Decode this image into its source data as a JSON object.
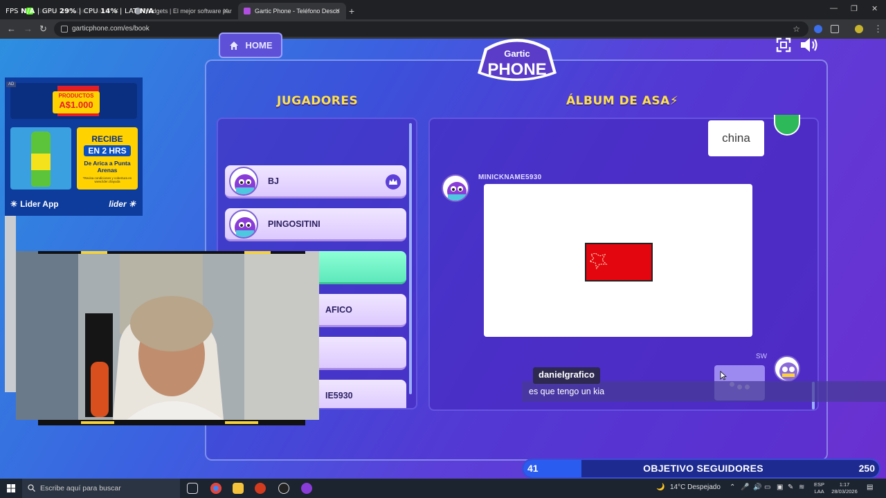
{
  "browser": {
    "hud": {
      "fps_label": "FPS",
      "fps_val": "N/A",
      "gpu_label": "GPU",
      "gpu_val": "29%",
      "cpu_label": "CPU",
      "cpu_val": "14%",
      "lat_label": "LAT",
      "lat_val": "N/A"
    },
    "tabs": [
      {
        "label": "Stream - Kick Dashboard",
        "active": false
      },
      {
        "label": "Widgets | El mejor software par",
        "active": false
      },
      {
        "label": "Gartic Phone - Teléfono Desco",
        "active": true
      }
    ],
    "url": "garticphone.com/es/book"
  },
  "game": {
    "home_label": "HOME",
    "logo_line1": "Gartic",
    "logo_line2": "PHONE",
    "players_title": "JUGADORES",
    "album_title": "ÁLBUM DE ASA⚡",
    "players": [
      {
        "name": "BJ",
        "crown": true
      },
      {
        "name": "PINGOSITINI"
      },
      {
        "name": ""
      },
      {
        "name": "AFICO"
      },
      {
        "name": ""
      },
      {
        "name": "IE5930"
      },
      {
        "name": "SW",
        "exit": true
      }
    ],
    "album": {
      "guess_text": "china",
      "drawing_author": "MINICKNAME5930",
      "next_author": "SW",
      "colors": {
        "flag_red": "#e3060f"
      }
    }
  },
  "ad": {
    "tag_line1": "PRODUCTOS",
    "tag_line2": "A$1.000",
    "promo_l1": "RECIBE",
    "promo_l2": "EN 2 HRS",
    "promo_l3": "De Arica a Punta Arenas",
    "promo_l4": "*Revisa condiciones y cobertura en www.lider.cl/ayuda",
    "app_name": "Lider App",
    "brand": "lider",
    "badge": "AD"
  },
  "stream": {
    "chat_user": "danielgrafico",
    "chat_message": "es que tengo un kia",
    "goal_current": "41",
    "goal_label": "OBJETIVO SEGUIDORES",
    "goal_max": "250",
    "goal_fraction": 0.164
  },
  "taskbar": {
    "search_placeholder": "Escribe aquí para buscar",
    "weather": "14°C  Despejado",
    "lang1": "ESP",
    "lang2": "LAA",
    "time": "1:17",
    "date": "28/03/2026"
  }
}
